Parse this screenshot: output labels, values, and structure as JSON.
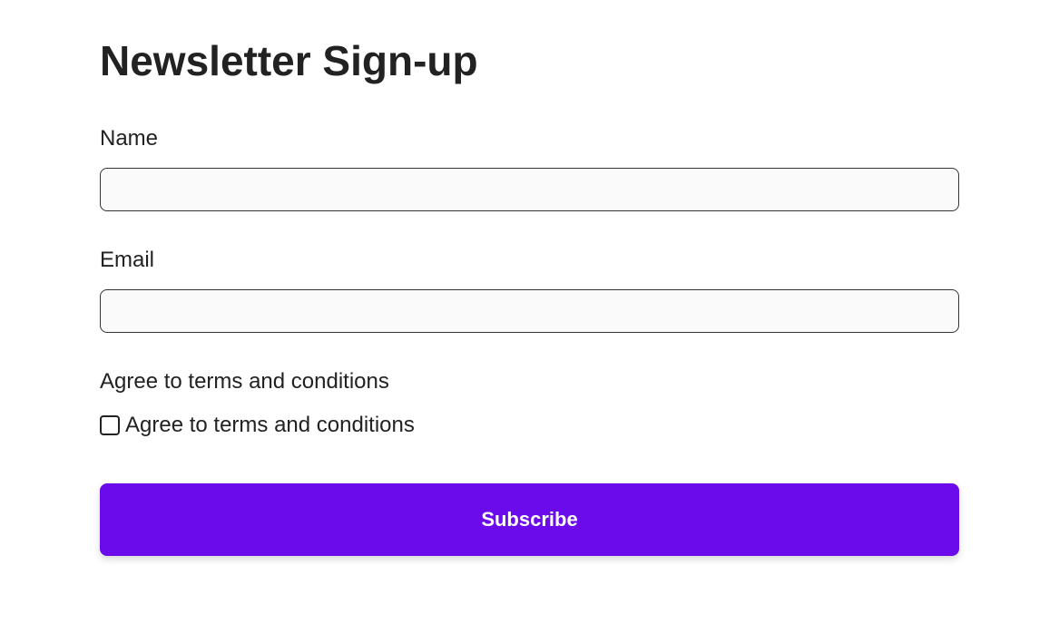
{
  "form": {
    "title": "Newsletter Sign-up",
    "name": {
      "label": "Name",
      "value": ""
    },
    "email": {
      "label": "Email",
      "value": ""
    },
    "terms": {
      "label": "Agree to terms and conditions",
      "checkbox_label": "Agree to terms and conditions",
      "checked": false
    },
    "submit_label": "Subscribe"
  }
}
